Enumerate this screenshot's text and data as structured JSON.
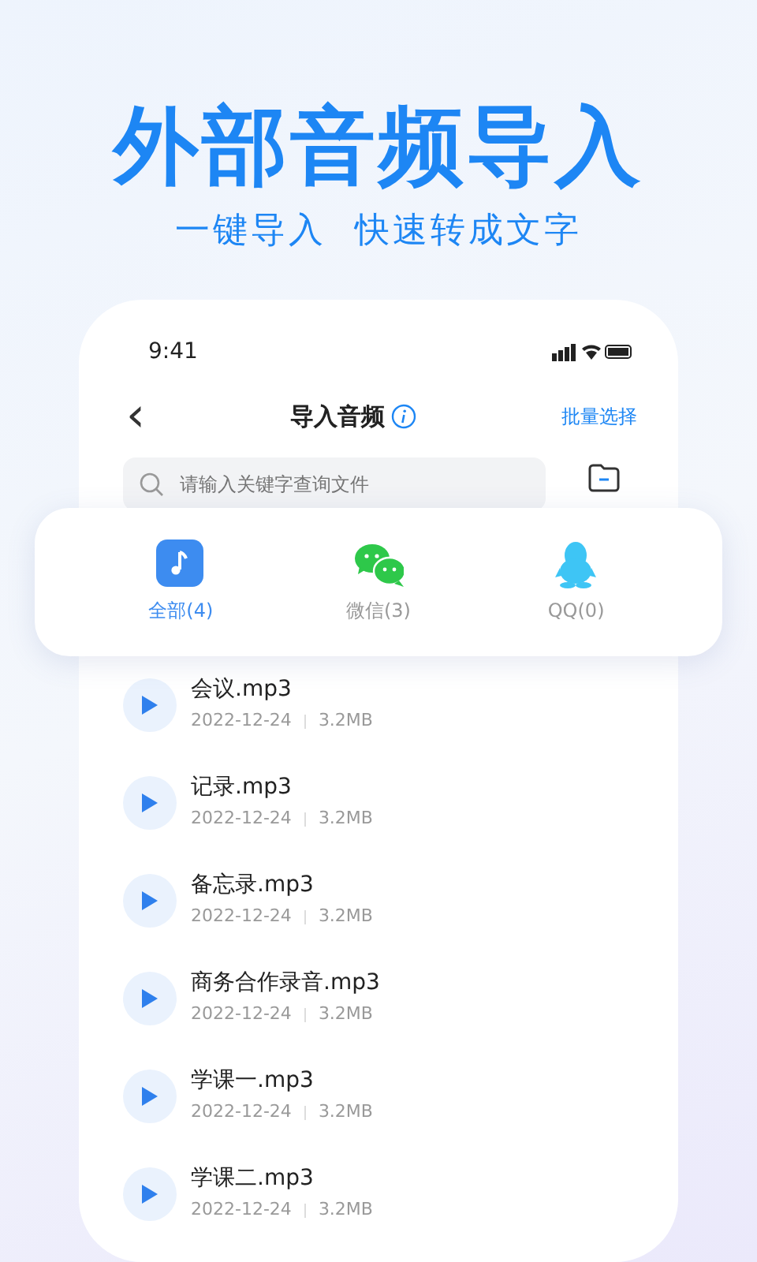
{
  "headline": "外部音频导入",
  "subtitle": "一键导入  快速转成文字",
  "status_bar": {
    "time": "9:41"
  },
  "nav": {
    "back": "‹",
    "title": "导入音频",
    "action": "批量选择"
  },
  "search": {
    "placeholder": "请输入关键字查询文件"
  },
  "sources": [
    {
      "kind": "music",
      "label": "全部(4)",
      "selected": true
    },
    {
      "kind": "wechat",
      "label": "微信(3)",
      "selected": false
    },
    {
      "kind": "qq",
      "label": "QQ(0)",
      "selected": false
    }
  ],
  "files": [
    {
      "name": "会议.mp3",
      "date": "2022-12-24",
      "size": "3.2MB"
    },
    {
      "name": "记录.mp3",
      "date": "2022-12-24",
      "size": "3.2MB"
    },
    {
      "name": "备忘录.mp3",
      "date": "2022-12-24",
      "size": "3.2MB"
    },
    {
      "name": "商务合作录音.mp3",
      "date": "2022-12-24",
      "size": "3.2MB"
    },
    {
      "name": "学课一.mp3",
      "date": "2022-12-24",
      "size": "3.2MB"
    },
    {
      "name": "学课二.mp3",
      "date": "2022-12-24",
      "size": "3.2MB"
    }
  ]
}
